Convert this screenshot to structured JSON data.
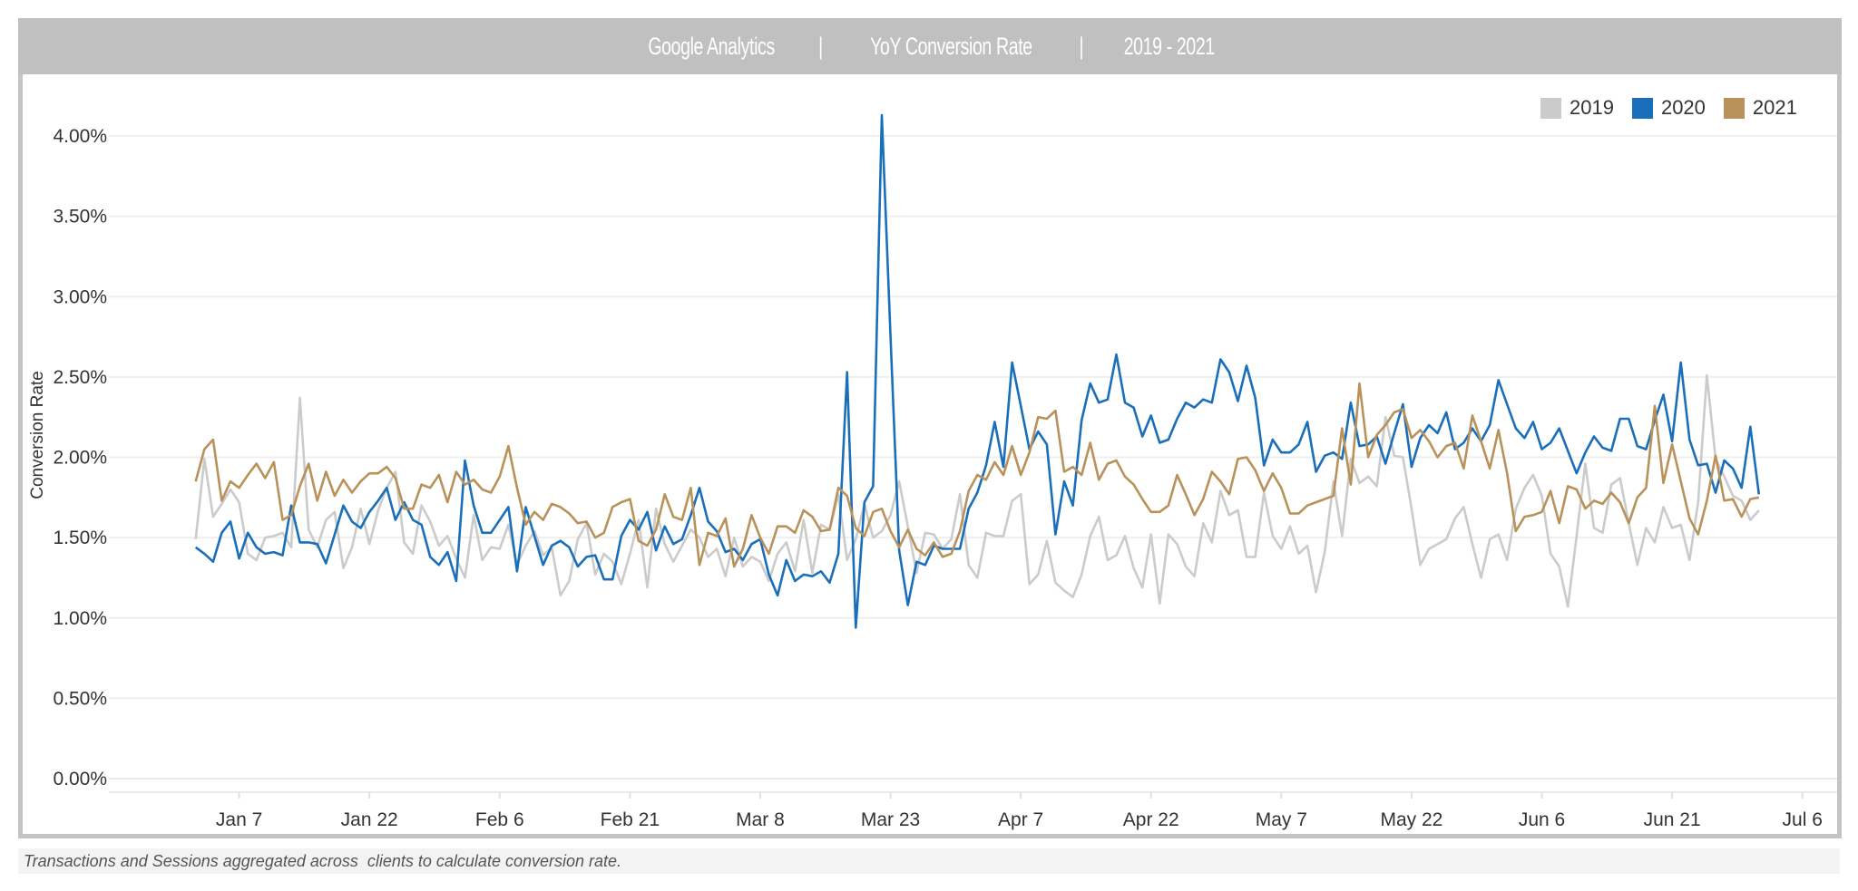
{
  "header": {
    "title_part1": "Google Analytics",
    "separator": "|",
    "title_part2": "YoY Conversion Rate",
    "title_part3": "2019 - 2021"
  },
  "footer": {
    "note": "Transactions and Sessions aggregated across  clients to calculate conversion rate."
  },
  "chart_data": {
    "type": "line",
    "title": "Google Analytics | YoY Conversion Rate | 2019 - 2021",
    "xlabel": "",
    "ylabel": "Conversion Rate",
    "ylim": [
      0,
      4.25
    ],
    "xlim": [
      "Dec 23",
      "Jul 10"
    ],
    "grid": true,
    "legend_position": "top-right",
    "y_ticks": [
      "0.00%",
      "0.50%",
      "1.00%",
      "1.50%",
      "2.00%",
      "2.50%",
      "3.00%",
      "3.50%",
      "4.00%"
    ],
    "y_tick_values": [
      0,
      0.5,
      1.0,
      1.5,
      2.0,
      2.5,
      3.0,
      3.5,
      4.0
    ],
    "x_ticks": [
      "Jan 7",
      "Jan 22",
      "Feb 6",
      "Feb 21",
      "Mar 8",
      "Mar 23",
      "Apr 7",
      "Apr 22",
      "May 7",
      "May 22",
      "Jun 6",
      "Jun 21",
      "Jul 6"
    ],
    "x": [
      "Jan 2",
      "Jan 3",
      "Jan 4",
      "Jan 5",
      "Jan 6",
      "Jan 7",
      "Jan 8",
      "Jan 9",
      "Jan 10",
      "Jan 11",
      "Jan 12",
      "Jan 13",
      "Jan 14",
      "Jan 15",
      "Jan 16",
      "Jan 17",
      "Jan 18",
      "Jan 19",
      "Jan 20",
      "Jan 21",
      "Jan 22",
      "Jan 23",
      "Jan 24",
      "Jan 25",
      "Jan 26",
      "Jan 27",
      "Jan 28",
      "Jan 29",
      "Jan 30",
      "Jan 31",
      "Feb 1",
      "Feb 2",
      "Feb 3",
      "Feb 4",
      "Feb 5",
      "Feb 6",
      "Feb 7",
      "Feb 8",
      "Feb 9",
      "Feb 10",
      "Feb 11",
      "Feb 12",
      "Feb 13",
      "Feb 14",
      "Feb 15",
      "Feb 16",
      "Feb 17",
      "Feb 18",
      "Feb 19",
      "Feb 20",
      "Feb 21",
      "Feb 22",
      "Feb 23",
      "Feb 24",
      "Feb 25",
      "Feb 26",
      "Feb 27",
      "Feb 28",
      "Mar 1",
      "Mar 2",
      "Mar 3",
      "Mar 4",
      "Mar 5",
      "Mar 6",
      "Mar 7",
      "Mar 8",
      "Mar 9",
      "Mar 10",
      "Mar 11",
      "Mar 12",
      "Mar 13",
      "Mar 14",
      "Mar 15",
      "Mar 16",
      "Mar 17",
      "Mar 18",
      "Mar 19",
      "Mar 20",
      "Mar 21",
      "Mar 22",
      "Mar 23",
      "Mar 24",
      "Mar 25",
      "Mar 26",
      "Mar 27",
      "Mar 28",
      "Mar 29",
      "Mar 30",
      "Mar 31",
      "Apr 1",
      "Apr 2",
      "Apr 3",
      "Apr 4",
      "Apr 5",
      "Apr 6",
      "Apr 7",
      "Apr 8",
      "Apr 9",
      "Apr 10",
      "Apr 11",
      "Apr 12",
      "Apr 13",
      "Apr 14",
      "Apr 15",
      "Apr 16",
      "Apr 17",
      "Apr 18",
      "Apr 19",
      "Apr 20",
      "Apr 21",
      "Apr 22",
      "Apr 23",
      "Apr 24",
      "Apr 25",
      "Apr 26",
      "Apr 27",
      "Apr 28",
      "Apr 29",
      "Apr 30",
      "May 1",
      "May 2",
      "May 3",
      "May 4",
      "May 5",
      "May 6",
      "May 7",
      "May 8",
      "May 9",
      "May 10",
      "May 11",
      "May 12",
      "May 13",
      "May 14",
      "May 15",
      "May 16",
      "May 17",
      "May 18",
      "May 19",
      "May 20",
      "May 21",
      "May 22",
      "May 23",
      "May 24",
      "May 25",
      "May 26",
      "May 27",
      "May 28",
      "May 29",
      "May 30",
      "May 31",
      "Jun 1",
      "Jun 2",
      "Jun 3",
      "Jun 4",
      "Jun 5",
      "Jun 6",
      "Jun 7",
      "Jun 8",
      "Jun 9",
      "Jun 10",
      "Jun 11",
      "Jun 12",
      "Jun 13",
      "Jun 14",
      "Jun 15",
      "Jun 16",
      "Jun 17",
      "Jun 18",
      "Jun 19",
      "Jun 20",
      "Jun 21",
      "Jun 22",
      "Jun 23",
      "Jun 24",
      "Jun 25",
      "Jun 26",
      "Jun 27",
      "Jun 28",
      "Jun 29",
      "Jun 30",
      "Jul 1"
    ],
    "series": [
      {
        "name": "2019",
        "color": "#cbcbcb",
        "values": [
          1.49,
          1.99,
          1.63,
          1.71,
          1.8,
          1.72,
          1.4,
          1.36,
          1.5,
          1.51,
          1.53,
          1.44,
          2.37,
          1.55,
          1.44,
          1.61,
          1.66,
          1.31,
          1.44,
          1.68,
          1.46,
          1.67,
          1.81,
          1.91,
          1.47,
          1.4,
          1.7,
          1.6,
          1.45,
          1.51,
          1.37,
          1.25,
          1.64,
          1.36,
          1.44,
          1.43,
          1.58,
          1.33,
          1.45,
          1.54,
          1.39,
          1.44,
          1.14,
          1.23,
          1.49,
          1.59,
          1.27,
          1.4,
          1.35,
          1.21,
          1.4,
          1.61,
          1.19,
          1.68,
          1.46,
          1.35,
          1.45,
          1.55,
          1.5,
          1.38,
          1.43,
          1.26,
          1.5,
          1.32,
          1.38,
          1.35,
          1.23,
          1.4,
          1.47,
          1.29,
          1.61,
          1.28,
          1.58,
          1.55,
          1.77,
          1.36,
          1.49,
          1.71,
          1.5,
          1.54,
          1.64,
          1.85,
          1.57,
          1.28,
          1.53,
          1.52,
          1.43,
          1.49,
          1.77,
          1.33,
          1.25,
          1.53,
          1.51,
          1.51,
          1.73,
          1.77,
          1.21,
          1.27,
          1.48,
          1.22,
          1.17,
          1.13,
          1.27,
          1.51,
          1.63,
          1.36,
          1.39,
          1.51,
          1.31,
          1.19,
          1.52,
          1.09,
          1.52,
          1.46,
          1.32,
          1.26,
          1.59,
          1.47,
          1.79,
          1.64,
          1.67,
          1.38,
          1.38,
          1.78,
          1.51,
          1.43,
          1.57,
          1.4,
          1.45,
          1.16,
          1.41,
          1.85,
          1.51,
          1.99,
          1.84,
          1.88,
          1.82,
          2.25,
          2.01,
          2.0,
          1.68,
          1.33,
          1.43,
          1.46,
          1.49,
          1.62,
          1.69,
          1.46,
          1.25,
          1.49,
          1.52,
          1.36,
          1.68,
          1.81,
          1.89,
          1.76,
          1.4,
          1.32,
          1.07,
          1.51,
          1.96,
          1.56,
          1.53,
          1.83,
          1.87,
          1.59,
          1.33,
          1.56,
          1.47,
          1.69,
          1.56,
          1.58,
          1.36,
          1.72,
          2.51,
          1.99,
          1.88,
          1.76,
          1.73,
          1.61,
          1.67
        ]
      },
      {
        "name": "2020",
        "color": "#1a6fba",
        "values": [
          1.44,
          1.4,
          1.35,
          1.53,
          1.6,
          1.37,
          1.53,
          1.44,
          1.4,
          1.41,
          1.39,
          1.7,
          1.47,
          1.47,
          1.46,
          1.34,
          1.52,
          1.7,
          1.6,
          1.56,
          1.66,
          1.73,
          1.81,
          1.61,
          1.72,
          1.61,
          1.58,
          1.38,
          1.33,
          1.41,
          1.23,
          1.98,
          1.7,
          1.53,
          1.53,
          1.61,
          1.69,
          1.29,
          1.69,
          1.51,
          1.33,
          1.45,
          1.48,
          1.44,
          1.32,
          1.38,
          1.39,
          1.24,
          1.24,
          1.51,
          1.61,
          1.55,
          1.66,
          1.42,
          1.57,
          1.46,
          1.49,
          1.64,
          1.81,
          1.6,
          1.54,
          1.41,
          1.43,
          1.36,
          1.46,
          1.49,
          1.27,
          1.14,
          1.36,
          1.23,
          1.27,
          1.26,
          1.29,
          1.22,
          1.4,
          2.53,
          0.94,
          1.72,
          1.82,
          4.13,
          2.75,
          1.42,
          1.08,
          1.35,
          1.33,
          1.45,
          1.43,
          1.43,
          1.43,
          1.68,
          1.78,
          1.95,
          2.22,
          1.94,
          2.59,
          2.32,
          2.05,
          2.16,
          2.08,
          1.52,
          1.85,
          1.7,
          2.23,
          2.46,
          2.34,
          2.36,
          2.64,
          2.34,
          2.31,
          2.13,
          2.26,
          2.09,
          2.11,
          2.24,
          2.34,
          2.31,
          2.36,
          2.34,
          2.61,
          2.53,
          2.35,
          2.57,
          2.37,
          1.95,
          2.11,
          2.03,
          2.03,
          2.08,
          2.22,
          1.91,
          2.01,
          2.03,
          1.99,
          2.34,
          2.07,
          2.08,
          2.13,
          1.96,
          2.15,
          2.33,
          1.94,
          2.12,
          2.2,
          2.15,
          2.28,
          2.05,
          2.09,
          2.18,
          2.1,
          2.2,
          2.48,
          2.33,
          2.18,
          2.12,
          2.22,
          2.05,
          2.09,
          2.18,
          2.04,
          1.9,
          2.03,
          2.13,
          2.06,
          2.04,
          2.24,
          2.24,
          2.07,
          2.05,
          2.23,
          2.39,
          2.1,
          2.59,
          2.11,
          1.95,
          1.96,
          1.78,
          1.98,
          1.93,
          1.81,
          2.19,
          1.77
        ]
      },
      {
        "name": "2021",
        "color": "#b8925a",
        "values": [
          1.85,
          2.05,
          2.11,
          1.73,
          1.85,
          1.81,
          1.89,
          1.96,
          1.87,
          1.97,
          1.61,
          1.64,
          1.82,
          1.96,
          1.73,
          1.91,
          1.76,
          1.86,
          1.78,
          1.85,
          1.9,
          1.9,
          1.94,
          1.87,
          1.68,
          1.68,
          1.83,
          1.81,
          1.89,
          1.72,
          1.91,
          1.83,
          1.86,
          1.8,
          1.78,
          1.88,
          2.07,
          1.81,
          1.58,
          1.66,
          1.61,
          1.71,
          1.69,
          1.65,
          1.59,
          1.6,
          1.5,
          1.53,
          1.69,
          1.72,
          1.74,
          1.48,
          1.45,
          1.55,
          1.77,
          1.63,
          1.61,
          1.81,
          1.33,
          1.53,
          1.51,
          1.62,
          1.32,
          1.43,
          1.64,
          1.5,
          1.4,
          1.57,
          1.57,
          1.53,
          1.67,
          1.63,
          1.54,
          1.55,
          1.81,
          1.76,
          1.56,
          1.51,
          1.66,
          1.68,
          1.54,
          1.44,
          1.55,
          1.43,
          1.39,
          1.47,
          1.38,
          1.4,
          1.54,
          1.79,
          1.89,
          1.86,
          1.97,
          1.89,
          2.07,
          1.89,
          2.03,
          2.25,
          2.24,
          2.29,
          1.91,
          1.94,
          1.89,
          2.09,
          1.86,
          1.96,
          1.98,
          1.88,
          1.83,
          1.74,
          1.66,
          1.66,
          1.7,
          1.89,
          1.77,
          1.64,
          1.74,
          1.91,
          1.85,
          1.77,
          1.99,
          2.0,
          1.92,
          1.79,
          1.9,
          1.81,
          1.65,
          1.65,
          1.7,
          1.72,
          1.74,
          1.76,
          2.18,
          1.83,
          2.46,
          2.0,
          2.14,
          2.2,
          2.28,
          2.3,
          2.12,
          2.17,
          2.1,
          2.0,
          2.07,
          2.09,
          1.93,
          2.26,
          2.1,
          1.93,
          2.17,
          1.9,
          1.54,
          1.63,
          1.64,
          1.66,
          1.79,
          1.59,
          1.82,
          1.8,
          1.68,
          1.73,
          1.71,
          1.78,
          1.72,
          1.59,
          1.75,
          1.81,
          2.32,
          1.84,
          2.08,
          1.85,
          1.62,
          1.52,
          1.73,
          2.01,
          1.73,
          1.74,
          1.63,
          1.74,
          1.75
        ]
      }
    ]
  }
}
